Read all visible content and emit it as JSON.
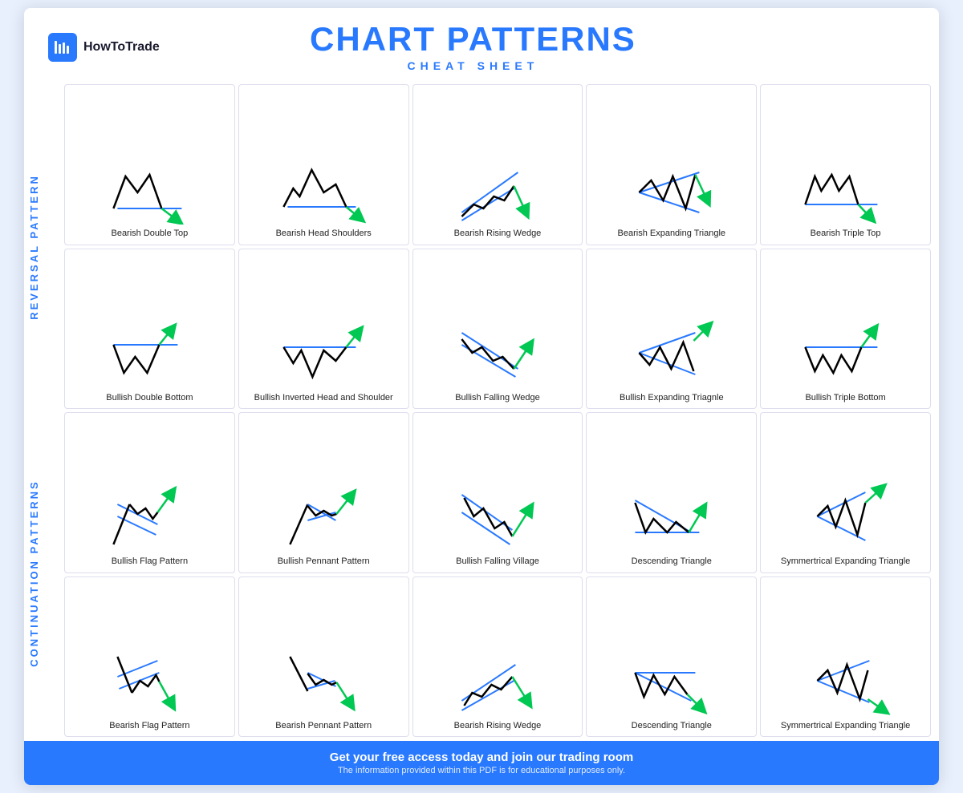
{
  "header": {
    "logo_text": "HowToTrade",
    "main_title": "CHART PATTERNS",
    "sub_title": "CHEAT SHEET"
  },
  "side_labels": {
    "reversal": "REVERSAL PATTERN",
    "continuation": "CONTINUATION PATTERNS"
  },
  "patterns": {
    "row1": [
      {
        "label": "Bearish Double Top"
      },
      {
        "label": "Bearish Head Shoulders"
      },
      {
        "label": "Bearish Rising Wedge"
      },
      {
        "label": "Bearish Expanding Triangle"
      },
      {
        "label": "Bearish Triple Top"
      }
    ],
    "row2": [
      {
        "label": "Bullish Double Bottom"
      },
      {
        "label": "Bullish Inverted Head and Shoulder"
      },
      {
        "label": "Bullish Falling Wedge"
      },
      {
        "label": "Bullish Expanding Triagnle"
      },
      {
        "label": "Bullish Triple Bottom"
      }
    ],
    "row3": [
      {
        "label": "Bullish Flag Pattern"
      },
      {
        "label": "Bullish Pennant Pattern"
      },
      {
        "label": "Bullish Falling Village"
      },
      {
        "label": "Descending Triangle"
      },
      {
        "label": "Symmertrical Expanding Triangle"
      }
    ],
    "row4": [
      {
        "label": "Bearish Flag Pattern"
      },
      {
        "label": "Bearish Pennant Pattern"
      },
      {
        "label": "Bearish Rising Wedge"
      },
      {
        "label": "Descending Triangle"
      },
      {
        "label": "Symmertrical Expanding Triangle"
      }
    ]
  },
  "footer": {
    "main": "Get your free access today and join our trading room",
    "sub": "The information provided within this PDF is for educational purposes only."
  }
}
